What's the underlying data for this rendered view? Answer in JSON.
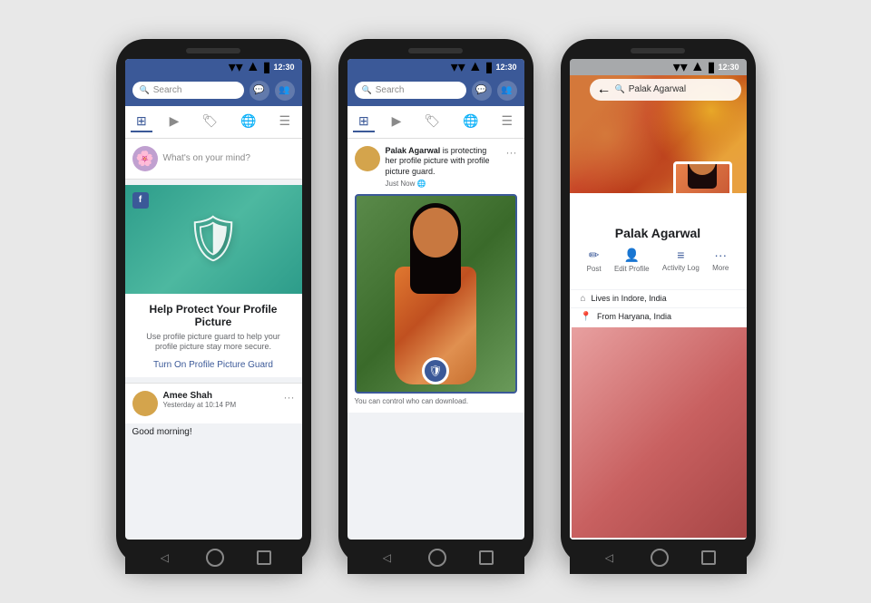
{
  "background": "#e8e8e8",
  "phones": [
    {
      "id": "phone1",
      "statusBar": {
        "time": "12:30",
        "icons": [
          "wifi",
          "signal",
          "battery"
        ]
      },
      "searchBar": {
        "placeholder": "Search"
      },
      "topbarIcons": [
        "messenger",
        "people"
      ],
      "navTabs": [
        "home",
        "play",
        "store",
        "globe",
        "menu"
      ],
      "postBox": {
        "placeholder": "What's on your mind?"
      },
      "protectCard": {
        "title": "Help Protect Your Profile Picture",
        "description": "Use profile picture guard to help your profile picture stay more secure.",
        "linkText": "Turn On Profile Picture Guard"
      },
      "post": {
        "name": "Amee Shah",
        "time": "Yesterday at 10:14 PM",
        "body": "Good morning!"
      }
    },
    {
      "id": "phone2",
      "statusBar": {
        "time": "12:30"
      },
      "searchBar": {
        "placeholder": "Search"
      },
      "story": {
        "name": "Palak Agarwal",
        "action": "is protecting her profile picture with profile picture guard.",
        "time": "Just Now",
        "caption": "You can control who can download."
      }
    },
    {
      "id": "phone3",
      "statusBar": {
        "time": "12:30"
      },
      "searchBar": {
        "value": "Palak Agarwal"
      },
      "profile": {
        "name": "Palak Agarwal",
        "actions": [
          "Post",
          "Edit Profile",
          "Activity Log",
          "More"
        ],
        "details": [
          {
            "icon": "home",
            "text": "Lives in Indore, India"
          },
          {
            "icon": "pin",
            "text": "From Haryana, India"
          }
        ]
      }
    }
  ],
  "colors": {
    "facebook_blue": "#3b5998",
    "background": "#f0f2f5",
    "teal": "#2d9c8a"
  }
}
